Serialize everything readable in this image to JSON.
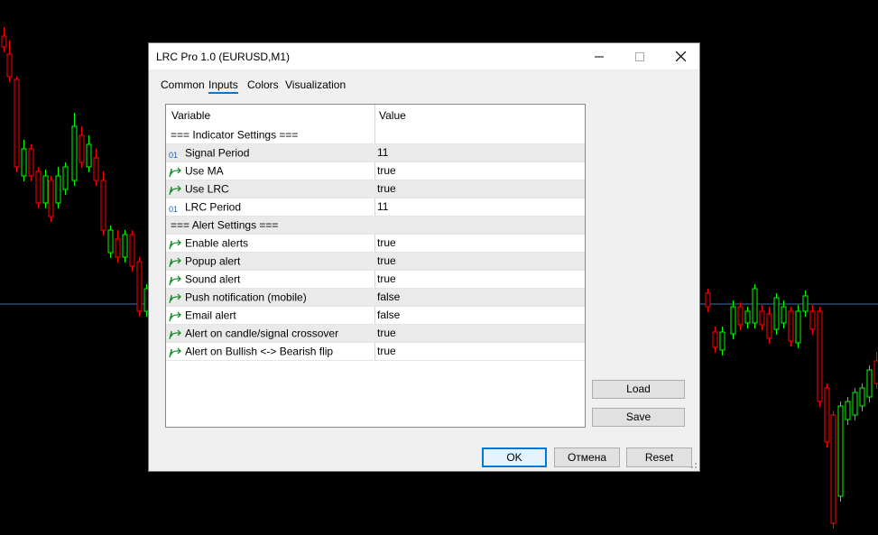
{
  "dialog": {
    "title": "LRC Pro 1.0 (EURUSD,M1)",
    "window_buttons": [
      "minimize-icon",
      "maximize-icon",
      "close-icon"
    ]
  },
  "tabs": [
    {
      "label": "Common",
      "active": false
    },
    {
      "label": "Inputs",
      "active": true
    },
    {
      "label": "Colors",
      "active": false
    },
    {
      "label": "Visualization",
      "active": false
    }
  ],
  "grid": {
    "headers": {
      "variable": "Variable",
      "value": "Value"
    },
    "rows": [
      {
        "type": "section",
        "variable": "=== Indicator Settings ===",
        "value": ""
      },
      {
        "type": "int",
        "icon": "integer-icon",
        "variable": "Signal Period",
        "value": "11"
      },
      {
        "type": "bool",
        "icon": "bool-arrow-icon",
        "variable": "Use MA",
        "value": "true"
      },
      {
        "type": "bool",
        "icon": "bool-arrow-icon",
        "variable": "Use LRC",
        "value": "true"
      },
      {
        "type": "int",
        "icon": "integer-icon",
        "variable": "LRC Period",
        "value": "11"
      },
      {
        "type": "section",
        "variable": "=== Alert Settings ===",
        "value": ""
      },
      {
        "type": "bool",
        "icon": "bool-arrow-icon",
        "variable": "Enable alerts",
        "value": "true"
      },
      {
        "type": "bool",
        "icon": "bool-arrow-icon",
        "variable": "Popup alert",
        "value": "true"
      },
      {
        "type": "bool",
        "icon": "bool-arrow-icon",
        "variable": "Sound alert",
        "value": "true"
      },
      {
        "type": "bool",
        "icon": "bool-arrow-icon",
        "variable": "Push notification (mobile)",
        "value": "false"
      },
      {
        "type": "bool",
        "icon": "bool-arrow-icon",
        "variable": "Email alert",
        "value": "false"
      },
      {
        "type": "bool",
        "icon": "bool-arrow-icon",
        "variable": "Alert on candle/signal crossover",
        "value": "true"
      },
      {
        "type": "bool",
        "icon": "bool-arrow-icon",
        "variable": "Alert on Bullish <-> Bearish flip",
        "value": "true"
      }
    ]
  },
  "side_buttons": {
    "load": "Load",
    "save": "Save"
  },
  "footer_buttons": {
    "ok": "OK",
    "cancel": "Отмена",
    "reset": "Reset"
  },
  "colors": {
    "bull": "#00ff00",
    "bear": "#ff0000",
    "hline": "#4a6fa5",
    "accent": "#0078d7",
    "icon_int": "#1e5fb4",
    "icon_bool": "#1a8f2a"
  }
}
